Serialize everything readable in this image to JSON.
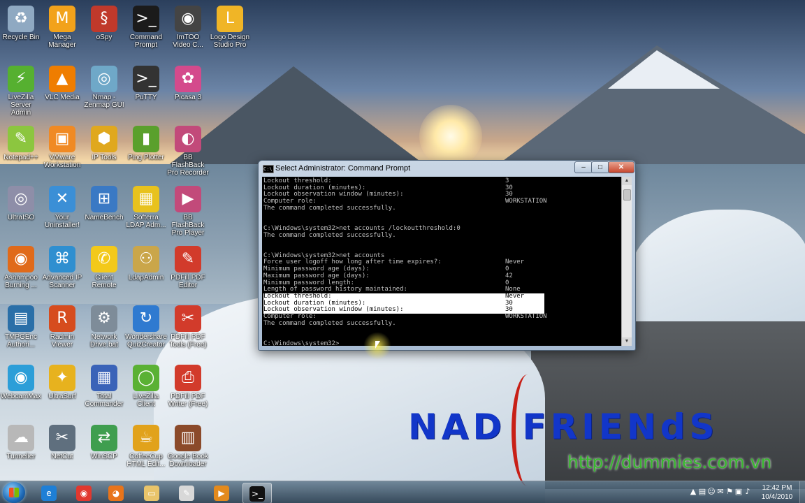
{
  "desktop_icons": [
    {
      "label": "Recycle Bin",
      "icon": "recycle-bin-icon",
      "color": "#8fa9c2",
      "glyph": "♻"
    },
    {
      "label": "Mega Manager",
      "icon": "mega-manager-icon",
      "color": "#f2a21b",
      "glyph": "M"
    },
    {
      "label": "oSpy",
      "icon": "ospy-icon",
      "color": "#c0392b",
      "glyph": "§"
    },
    {
      "label": "Command Prompt",
      "icon": "command-prompt-icon",
      "color": "#1b1b1b",
      "glyph": ">_"
    },
    {
      "label": "ImTOO Video C...",
      "icon": "video-converter-icon",
      "color": "#444444",
      "glyph": "◉"
    },
    {
      "label": "Logo Design Studio Pro",
      "icon": "logo-design-icon",
      "color": "#f0b526",
      "glyph": "L"
    },
    {
      "label": "LiveZilla Server Admin",
      "icon": "livezilla-icon",
      "color": "#56b030",
      "glyph": "⚡"
    },
    {
      "label": "VLC Media",
      "icon": "vlc-icon",
      "color": "#ef7d00",
      "glyph": "▲"
    },
    {
      "label": "Nmap - Zenmap GUI",
      "icon": "nmap-icon",
      "color": "#6fa8c8",
      "glyph": "◎"
    },
    {
      "label": "PuTTY",
      "icon": "putty-icon",
      "color": "#333333",
      "glyph": ">_"
    },
    {
      "label": "Picasa 3",
      "icon": "picasa-icon",
      "color": "#d44a8c",
      "glyph": "✿"
    },
    {
      "label": "Notepad++",
      "icon": "notepadpp-icon",
      "color": "#8cc63f",
      "glyph": "✎"
    },
    {
      "label": "VMware Workstation",
      "icon": "vmware-icon",
      "color": "#f08a24",
      "glyph": "▣"
    },
    {
      "label": "IP Tools",
      "icon": "ip-tools-icon",
      "color": "#e0a81e",
      "glyph": "⬢"
    },
    {
      "label": "Ping Plotter",
      "icon": "ping-plotter-icon",
      "color": "#5aa02c",
      "glyph": "▮"
    },
    {
      "label": "BB FlashBack Pro Recorder",
      "icon": "bb-recorder-icon",
      "color": "#c24a7a",
      "glyph": "◐"
    },
    {
      "label": "UltraISO",
      "icon": "ultraiso-icon",
      "color": "#8e8ea8",
      "glyph": "◎"
    },
    {
      "label": "Your Uninstaller!",
      "icon": "uninstaller-icon",
      "color": "#3b8fd6",
      "glyph": "✕"
    },
    {
      "label": "NameBench",
      "icon": "namebench-icon",
      "color": "#3a79c4",
      "glyph": "⊞"
    },
    {
      "label": "Softerra LDAP Adm...",
      "icon": "softerra-icon",
      "color": "#e8c21d",
      "glyph": "▦"
    },
    {
      "label": "BB FlashBack Pro Player",
      "icon": "bb-player-icon",
      "color": "#c24a7a",
      "glyph": "▶"
    },
    {
      "label": "Ashampoo Burning ...",
      "icon": "ashampoo-icon",
      "color": "#e06a1a",
      "glyph": "◉"
    },
    {
      "label": "Advanced IP Scanner",
      "icon": "ip-scanner-icon",
      "color": "#2f8fd0",
      "glyph": "⌘"
    },
    {
      "label": "Client Remote",
      "icon": "client-remote-icon",
      "color": "#f3c91a",
      "glyph": "✆"
    },
    {
      "label": "LdapAdmin",
      "icon": "ldapadmin-icon",
      "color": "#caa64a",
      "glyph": "⚇"
    },
    {
      "label": "PDFill PDF Editor",
      "icon": "pdfill-editor-icon",
      "color": "#d23b2b",
      "glyph": "✎"
    },
    {
      "label": "TMPGEnc Authori...",
      "icon": "tmpgenc-icon",
      "color": "#2a6fa8",
      "glyph": "▤"
    },
    {
      "label": "Radmin Viewer",
      "icon": "radmin-icon",
      "color": "#d64c1e",
      "glyph": "R"
    },
    {
      "label": "Network Drive.bat",
      "icon": "batch-file-icon",
      "color": "#7e8c99",
      "glyph": "⚙"
    },
    {
      "label": "Wondershare QuizCreator",
      "icon": "quizcreator-icon",
      "color": "#2f7ad0",
      "glyph": "↻"
    },
    {
      "label": "PDFill PDF Tools (Free)",
      "icon": "pdfill-tools-icon",
      "color": "#d23b2b",
      "glyph": "✂"
    },
    {
      "label": "WebcamMax",
      "icon": "webcammax-icon",
      "color": "#2c9ed8",
      "glyph": "◉"
    },
    {
      "label": "UltraSurf",
      "icon": "ultrasurf-icon",
      "color": "#e7b21e",
      "glyph": "✦"
    },
    {
      "label": "Total Commander",
      "icon": "total-commander-icon",
      "color": "#3a63b8",
      "glyph": "▦"
    },
    {
      "label": "LiveZilla Client",
      "icon": "livezilla-client-icon",
      "color": "#5ab134",
      "glyph": "◯"
    },
    {
      "label": "PDFill PDF Writer (Free)",
      "icon": "pdfill-writer-icon",
      "color": "#d23b2b",
      "glyph": "⎙"
    },
    {
      "label": "Tunnelier",
      "icon": "tunnelier-icon",
      "color": "#b8b8b8",
      "glyph": "☁"
    },
    {
      "label": "NetCut",
      "icon": "netcut-icon",
      "color": "#5f6f7e",
      "glyph": "✂"
    },
    {
      "label": "WinSCP",
      "icon": "winscp-icon",
      "color": "#3f9e4f",
      "glyph": "⇄"
    },
    {
      "label": "CoffeeCup HTML Edit...",
      "icon": "coffeecup-icon",
      "color": "#e1a21b",
      "glyph": "☕"
    },
    {
      "label": "Google Book Downloader",
      "icon": "book-downloader-icon",
      "color": "#8b4a2a",
      "glyph": "▥"
    }
  ],
  "cmd_window": {
    "title": "Select Administrator: Command Prompt",
    "title_icon_text": "C:\\",
    "min_label": "–",
    "max_label": "□",
    "close_label": "✕",
    "lines": [
      {
        "text": "Lockout threshold:",
        "value": "3",
        "selected": false
      },
      {
        "text": "Lockout duration (minutes):",
        "value": "30",
        "selected": false
      },
      {
        "text": "Lockout observation window (minutes):",
        "value": "30",
        "selected": false
      },
      {
        "text": "Computer role:",
        "value": "WORKSTATION",
        "selected": false
      },
      {
        "text": "The command completed successfully.",
        "value": "",
        "selected": false
      },
      {
        "text": "",
        "value": "",
        "selected": false
      },
      {
        "text": "",
        "value": "",
        "selected": false
      },
      {
        "text": "C:\\Windows\\system32>net accounts /lockoutthreshold:0",
        "value": "",
        "selected": false
      },
      {
        "text": "The command completed successfully.",
        "value": "",
        "selected": false
      },
      {
        "text": "",
        "value": "",
        "selected": false
      },
      {
        "text": "",
        "value": "",
        "selected": false
      },
      {
        "text": "C:\\Windows\\system32>net accounts",
        "value": "",
        "selected": false
      },
      {
        "text": "Force user logoff how long after time expires?:",
        "value": "Never",
        "selected": false
      },
      {
        "text": "Minimum password age (days):",
        "value": "0",
        "selected": false
      },
      {
        "text": "Maximum password age (days):",
        "value": "42",
        "selected": false
      },
      {
        "text": "Minimum password length:",
        "value": "0",
        "selected": false
      },
      {
        "text": "Length of password history maintained:",
        "value": "None",
        "selected": false
      },
      {
        "text": "Lockout threshold:",
        "value": "Never",
        "selected": true
      },
      {
        "text": "Lockout duration (minutes):",
        "value": "30",
        "selected": true
      },
      {
        "text": "Lockout observation window (minutes):",
        "value": "30",
        "selected": true
      },
      {
        "text": "Computer role:",
        "value": "WORKSTATION",
        "selected": false
      },
      {
        "text": "The command completed successfully.",
        "value": "",
        "selected": false
      },
      {
        "text": "",
        "value": "",
        "selected": false
      },
      {
        "text": "",
        "value": "",
        "selected": false
      },
      {
        "text": "C:\\Windows\\system32>",
        "value": "",
        "selected": false
      }
    ]
  },
  "watermark": {
    "brand": "NAD FRIENdS",
    "url": "http://dummies.com.vn"
  },
  "taskbar": {
    "pinned": [
      {
        "name": "ie",
        "icon": "internet-explorer-icon",
        "glyph": "e",
        "color": "#1e7fd6",
        "active": false
      },
      {
        "name": "chrome",
        "icon": "chrome-icon",
        "glyph": "◉",
        "color": "#e1382f",
        "active": false
      },
      {
        "name": "firefox",
        "icon": "firefox-icon",
        "glyph": "◕",
        "color": "#e8741a",
        "active": false
      },
      {
        "name": "explorer",
        "icon": "folder-icon",
        "glyph": "▭",
        "color": "#e9c46a",
        "active": false
      },
      {
        "name": "notepad",
        "icon": "notepad-icon",
        "glyph": "✎",
        "color": "#d8d8d8",
        "active": false
      },
      {
        "name": "media",
        "icon": "media-player-icon",
        "glyph": "▶",
        "color": "#e38a1d",
        "active": false
      },
      {
        "name": "cmd",
        "icon": "command-prompt-taskbar-icon",
        "glyph": ">_",
        "color": "#111111",
        "active": true
      }
    ],
    "tray_icons": [
      {
        "icon": "tray-arrow-icon",
        "glyph": "▲"
      },
      {
        "icon": "tray-app1-icon",
        "glyph": "▤"
      },
      {
        "icon": "tray-app2-icon",
        "glyph": "☺"
      },
      {
        "icon": "tray-app3-icon",
        "glyph": "✉"
      },
      {
        "icon": "tray-flag-icon",
        "glyph": "⚑"
      },
      {
        "icon": "tray-network-icon",
        "glyph": "▣"
      },
      {
        "icon": "tray-volume-icon",
        "glyph": "♪"
      }
    ],
    "clock_time": "12:42 PM",
    "clock_date": "10/4/2010"
  }
}
